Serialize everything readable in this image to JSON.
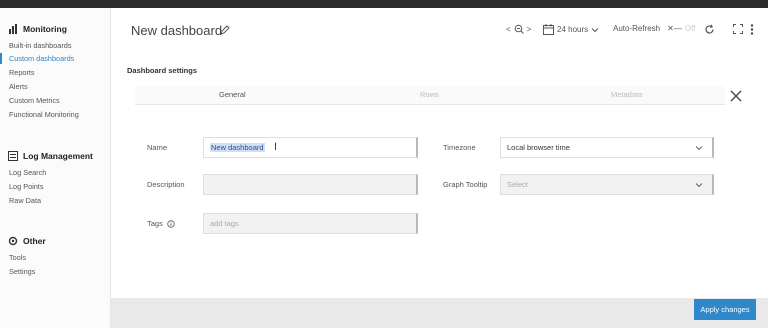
{
  "sidebar": {
    "monitoring": {
      "title": "Monitoring",
      "items": [
        "Built-in dashboards",
        "Custom dashboards",
        "Reports",
        "Alerts",
        "Custom Metrics",
        "Functional Monitoring"
      ]
    },
    "log_management": {
      "title": "Log Management",
      "items": [
        "Log Search",
        "Log Points",
        "Raw Data"
      ]
    },
    "other": {
      "title": "Other",
      "items": [
        "Tools",
        "Settings"
      ]
    },
    "active_item": "Custom dashboards"
  },
  "header": {
    "title": "New dashboard",
    "time_range": "24 hours",
    "auto_refresh_label": "Auto-Refresh",
    "auto_refresh_value": "Off"
  },
  "settings": {
    "title": "Dashboard settings",
    "tabs": [
      "General",
      "Rows",
      "Metadata"
    ],
    "fields": {
      "name_label": "Name",
      "name_value": "New dashboard",
      "description_label": "Description",
      "description_value": "",
      "tags_label": "Tags",
      "tags_placeholder": "add tags",
      "timezone_label": "Timezone",
      "timezone_value": "Local browser time",
      "graph_tooltip_label": "Graph Tooltip",
      "graph_tooltip_placeholder": "Select"
    },
    "apply_label": "Apply changes"
  },
  "colors": {
    "accent": "#2f86c8",
    "apply_button": "#2f88c9"
  }
}
